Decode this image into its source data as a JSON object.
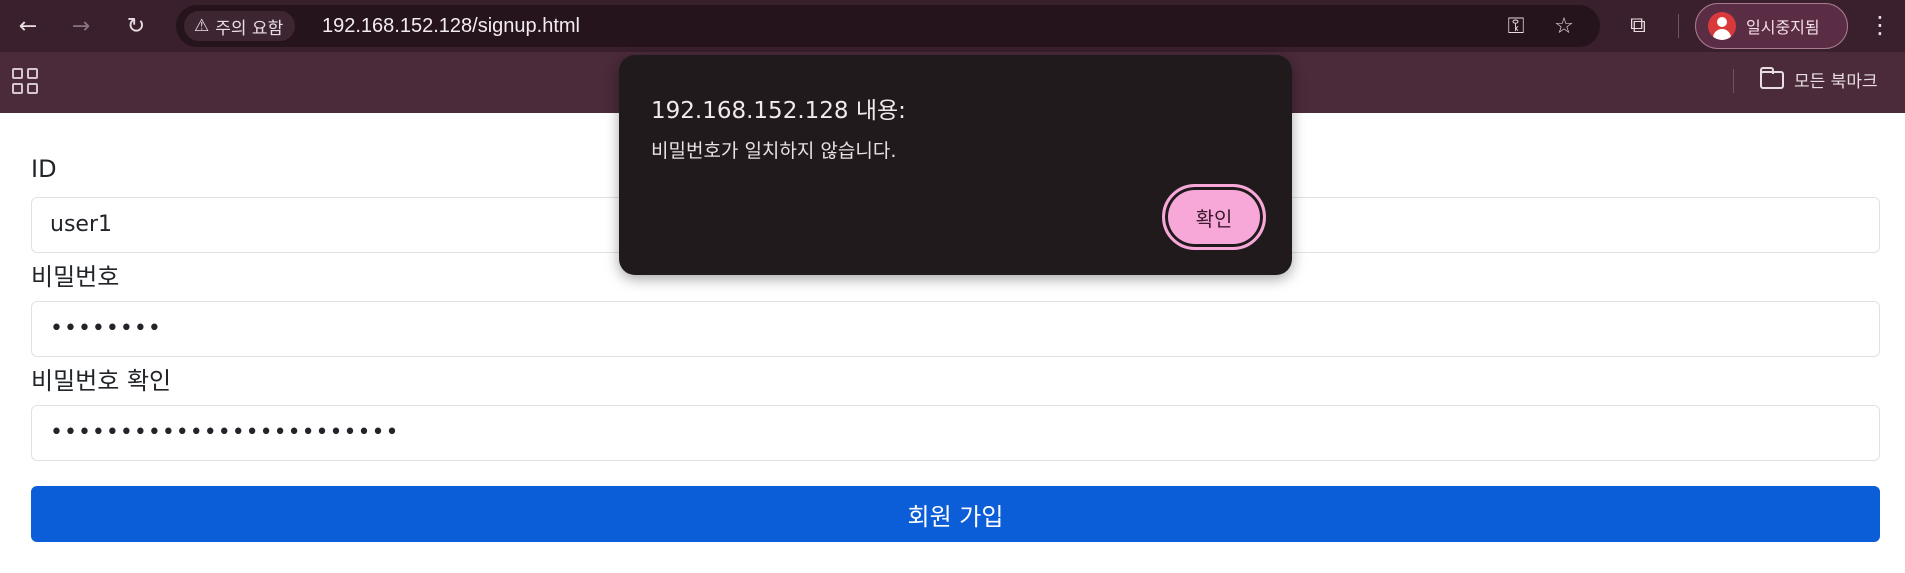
{
  "browser": {
    "security_label": "주의 요함",
    "url": "192.168.152.128/signup.html",
    "profile_label": "일시중지됨",
    "all_bookmarks_label": "모든 북마크"
  },
  "form": {
    "id_label": "ID",
    "id_value": "user1",
    "password_label": "비밀번호",
    "password_value": "••••••••",
    "password_confirm_label": "비밀번호 확인",
    "password_confirm_value": "•••••••••••••••••••••••••",
    "submit_label": "회원 가입"
  },
  "dialog": {
    "title": "192.168.152.128 내용:",
    "message": "비밀번호가 일치하지 않습니다.",
    "ok_label": "확인"
  },
  "colors": {
    "toolbar": "#3a1f2c",
    "bookmarks_bar": "#4b2a3a",
    "submit_button": "#0b5ed7",
    "dialog_bg": "#201a1d",
    "dialog_button": "#f7a8d8"
  },
  "icons": [
    "back-icon",
    "forward-icon",
    "reload-icon",
    "warning-icon",
    "key-icon",
    "star-icon",
    "extensions-icon",
    "avatar-icon",
    "more-menu-icon",
    "apps-icon",
    "folder-icon"
  ]
}
